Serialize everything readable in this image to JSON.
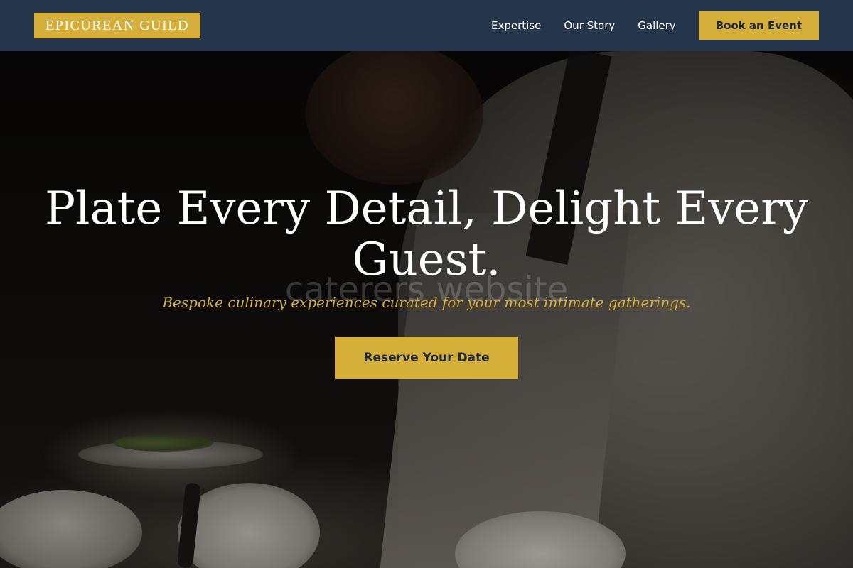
{
  "brand": {
    "name": "EPICUREAN GUILD"
  },
  "nav": {
    "links": [
      "Expertise",
      "Our Story",
      "Gallery"
    ],
    "cta_label": "Book an Event"
  },
  "hero": {
    "title": "Plate Every Detail, Delight Every Guest.",
    "watermark": "caterers website",
    "subtitle": "Bespoke culinary experiences curated for your most intimate gatherings.",
    "cta_label": "Reserve Your Date"
  },
  "colors": {
    "accent": "#d6ae3a",
    "nav_background": "#26374d",
    "text_light": "#ffffff",
    "button_text": "#1f2937"
  }
}
